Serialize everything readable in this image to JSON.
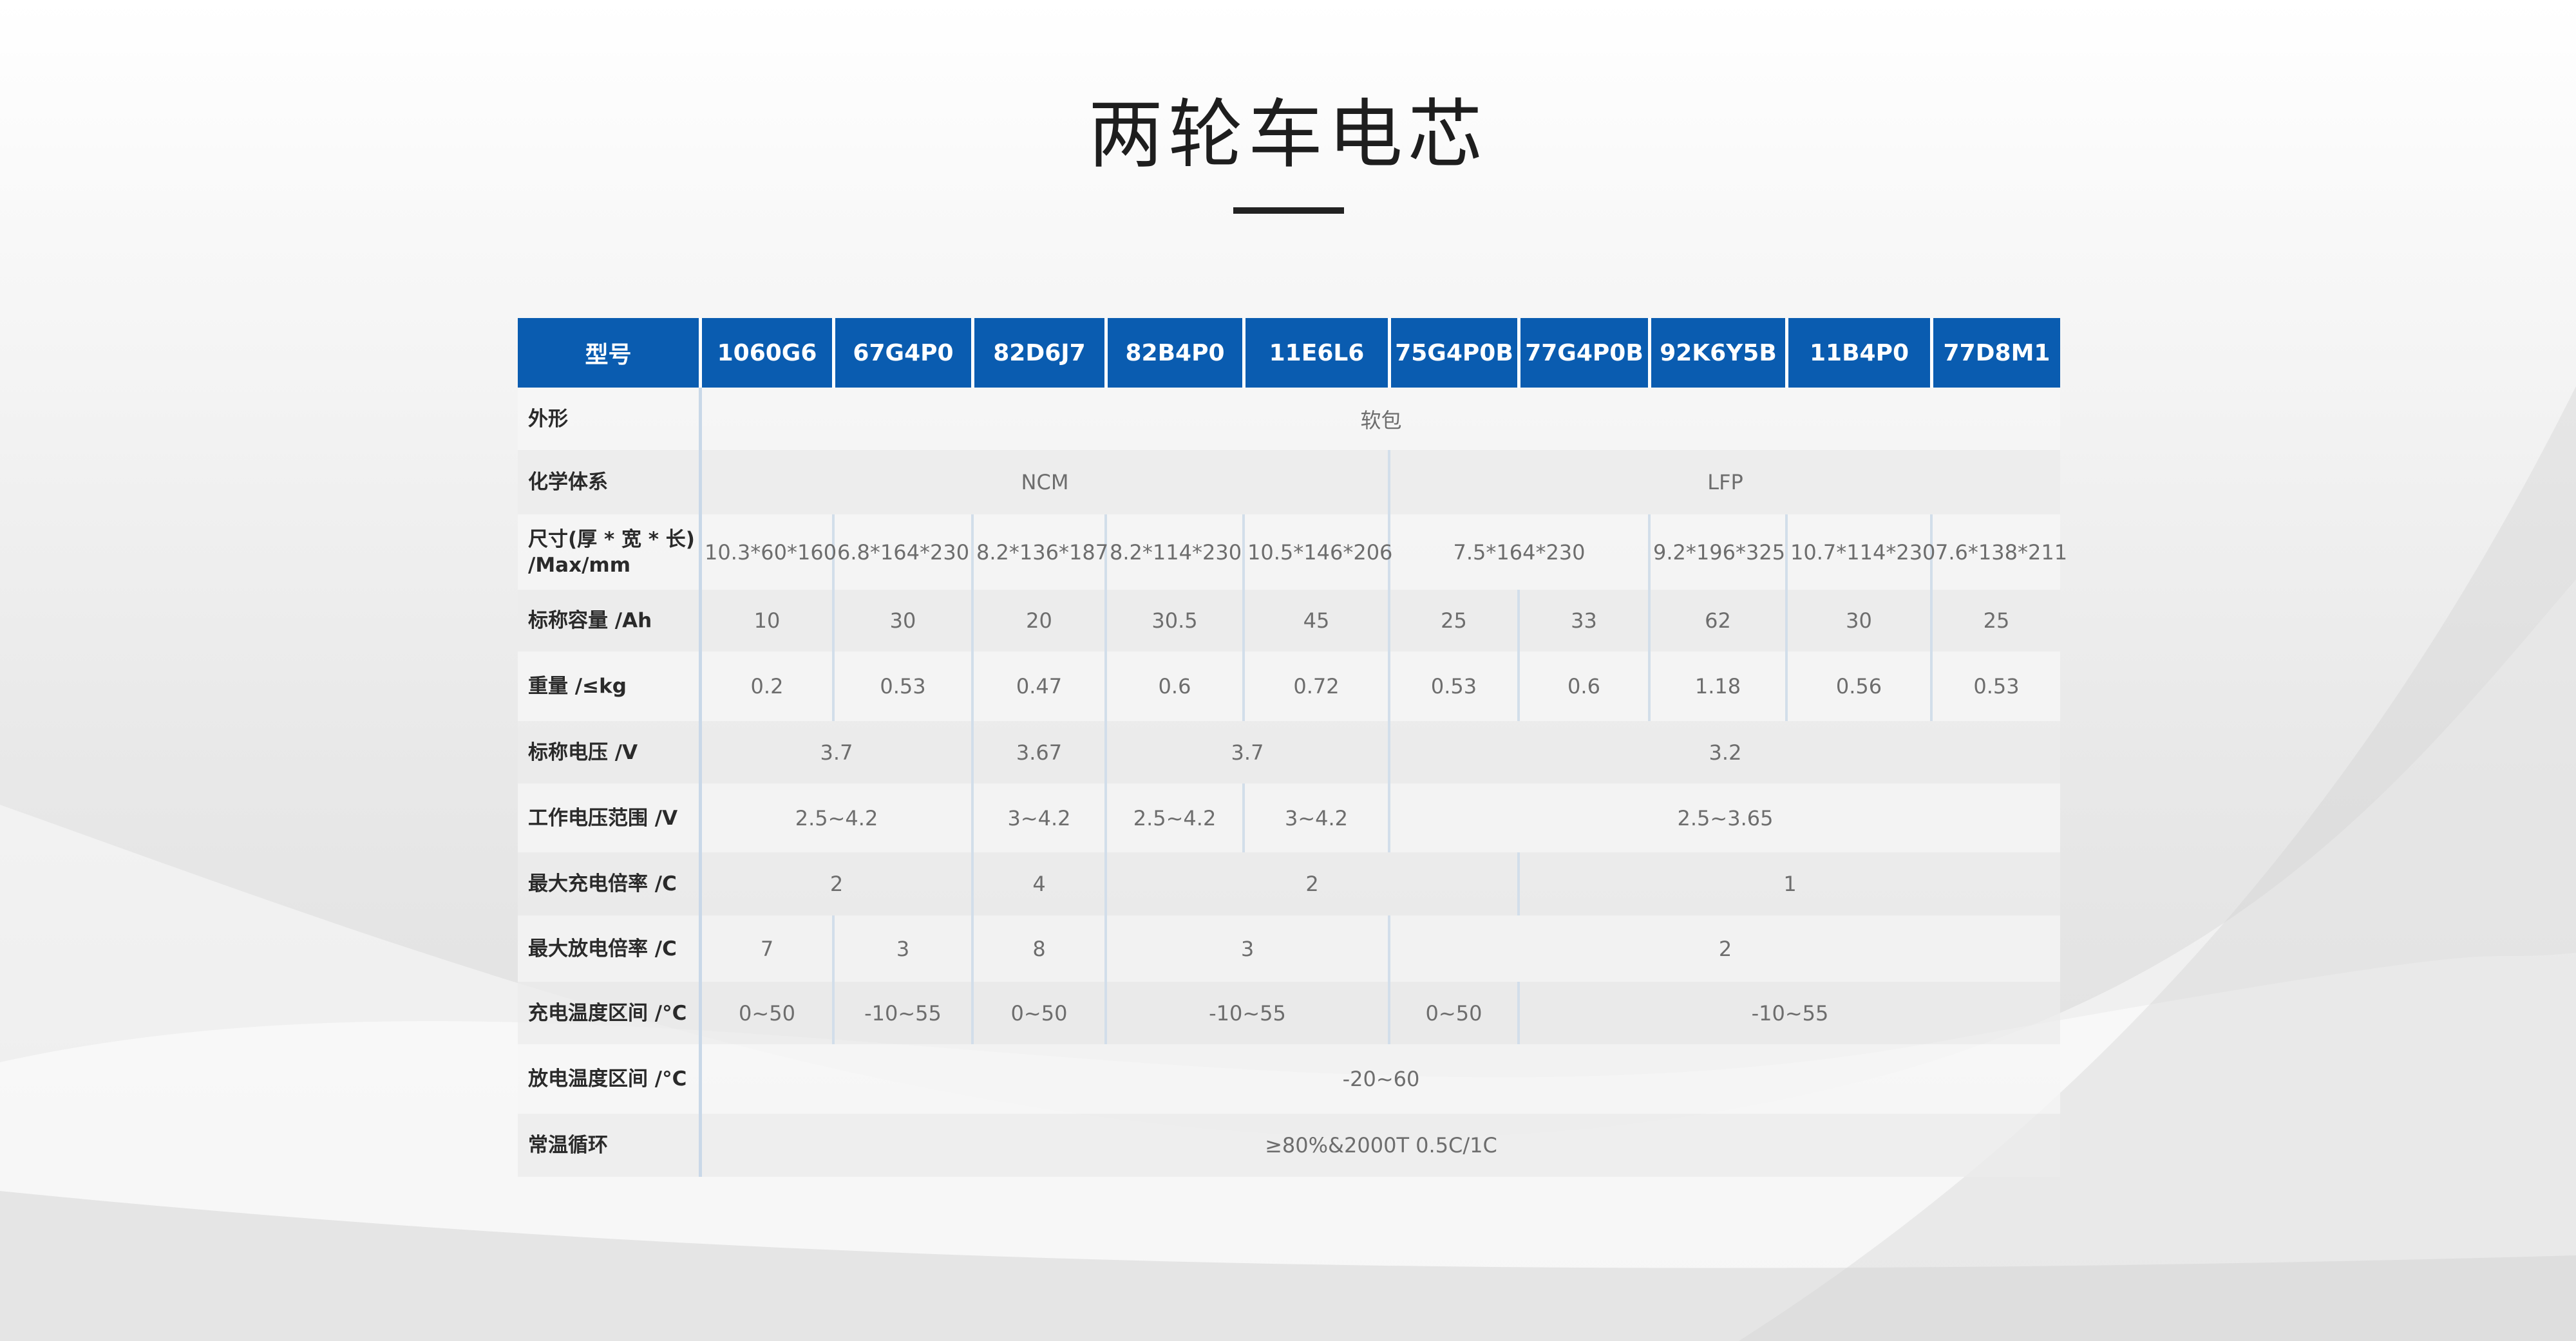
{
  "title": "两轮车电芯",
  "colors": {
    "header": "#0a5cb0",
    "title_bar": "#222222"
  },
  "header": {
    "label": "型号",
    "models": [
      "1060G6",
      "67G4P0",
      "82D6J7",
      "82B4P0",
      "11E6L6",
      "75G4P0B",
      "77G4P0B",
      "92K6Y5B",
      "11B4P0",
      "77D8M1"
    ]
  },
  "rows": [
    {
      "label": "外形",
      "cells": [
        {
          "text": "软包",
          "span": 10
        }
      ]
    },
    {
      "label": "化学体系",
      "cells": [
        {
          "text": "NCM",
          "span": 5
        },
        {
          "text": "LFP",
          "span": 5
        }
      ]
    },
    {
      "label": "尺寸(厚 * 宽 * 长) /Max/mm",
      "cells": [
        {
          "text": "10.3*60*160",
          "span": 1
        },
        {
          "text": "6.8*164*230",
          "span": 1
        },
        {
          "text": "8.2*136*187",
          "span": 1
        },
        {
          "text": "8.2*114*230",
          "span": 1
        },
        {
          "text": "10.5*146*206",
          "span": 1
        },
        {
          "text": "7.5*164*230",
          "span": 2
        },
        {
          "text": "9.2*196*325",
          "span": 1
        },
        {
          "text": "10.7*114*230",
          "span": 1
        },
        {
          "text": "7.6*138*211",
          "span": 1
        }
      ]
    },
    {
      "label": "标称容量 /Ah",
      "cells": [
        {
          "text": "10",
          "span": 1
        },
        {
          "text": "30",
          "span": 1
        },
        {
          "text": "20",
          "span": 1
        },
        {
          "text": "30.5",
          "span": 1
        },
        {
          "text": "45",
          "span": 1
        },
        {
          "text": "25",
          "span": 1
        },
        {
          "text": "33",
          "span": 1
        },
        {
          "text": "62",
          "span": 1
        },
        {
          "text": "30",
          "span": 1
        },
        {
          "text": "25",
          "span": 1
        }
      ]
    },
    {
      "label": "重量 /≤kg",
      "cells": [
        {
          "text": "0.2",
          "span": 1
        },
        {
          "text": "0.53",
          "span": 1
        },
        {
          "text": "0.47",
          "span": 1
        },
        {
          "text": "0.6",
          "span": 1
        },
        {
          "text": "0.72",
          "span": 1
        },
        {
          "text": "0.53",
          "span": 1
        },
        {
          "text": "0.6",
          "span": 1
        },
        {
          "text": "1.18",
          "span": 1
        },
        {
          "text": "0.56",
          "span": 1
        },
        {
          "text": "0.53",
          "span": 1
        }
      ]
    },
    {
      "label": "标称电压 /V",
      "cells": [
        {
          "text": "3.7",
          "span": 2
        },
        {
          "text": "3.67",
          "span": 1
        },
        {
          "text": "3.7",
          "span": 2
        },
        {
          "text": "3.2",
          "span": 5
        }
      ]
    },
    {
      "label": "工作电压范围 /V",
      "cells": [
        {
          "text": "2.5~4.2",
          "span": 2
        },
        {
          "text": "3~4.2",
          "span": 1
        },
        {
          "text": "2.5~4.2",
          "span": 1
        },
        {
          "text": "3~4.2",
          "span": 1
        },
        {
          "text": "2.5~3.65",
          "span": 5
        }
      ]
    },
    {
      "label": "最大充电倍率 /C",
      "cells": [
        {
          "text": "2",
          "span": 2
        },
        {
          "text": "4",
          "span": 1
        },
        {
          "text": "2",
          "span": 3
        },
        {
          "text": "1",
          "span": 4
        }
      ]
    },
    {
      "label": "最大放电倍率 /C",
      "cells": [
        {
          "text": "7",
          "span": 1
        },
        {
          "text": "3",
          "span": 1
        },
        {
          "text": "8",
          "span": 1
        },
        {
          "text": "3",
          "span": 2
        },
        {
          "text": "2",
          "span": 5
        }
      ]
    },
    {
      "label": "充电温度区间 /°C",
      "cells": [
        {
          "text": "0~50",
          "span": 1
        },
        {
          "text": "-10~55",
          "span": 1
        },
        {
          "text": "0~50",
          "span": 1
        },
        {
          "text": "-10~55",
          "span": 2
        },
        {
          "text": "0~50",
          "span": 1
        },
        {
          "text": "-10~55",
          "span": 4
        }
      ]
    },
    {
      "label": "放电温度区间 /°C",
      "cells": [
        {
          "text": "-20~60",
          "span": 10
        }
      ]
    },
    {
      "label": "常温循环",
      "cells": [
        {
          "text": "≥80%&2000T 0.5C/1C",
          "span": 10
        }
      ]
    }
  ]
}
